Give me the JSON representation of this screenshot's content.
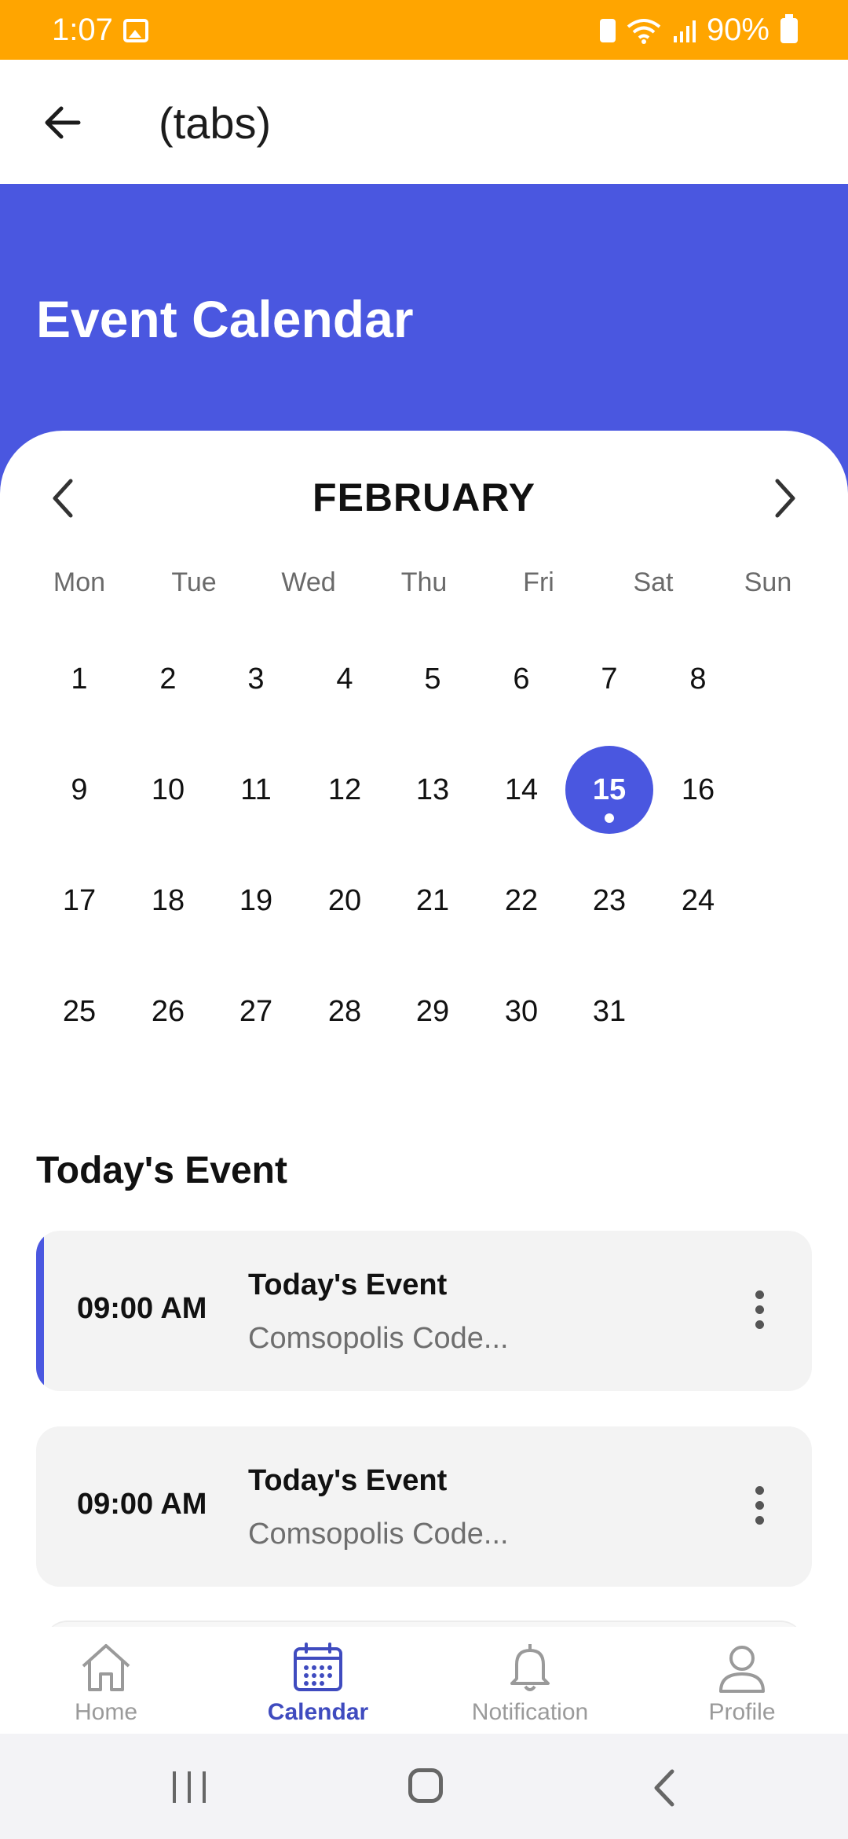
{
  "status": {
    "time": "1:07",
    "battery": "90%",
    "icons": [
      "image-icon",
      "battery-saver-icon",
      "wifi-icon",
      "signal-icon",
      "battery-icon"
    ]
  },
  "appbar": {
    "title": "(tabs)",
    "back_icon": "arrow-left-icon"
  },
  "banner": {
    "title": "Event Calendar",
    "color": "#4A57E0"
  },
  "calendar": {
    "month": "FEBRUARY",
    "weekdays": [
      "Mon",
      "Tue",
      "Wed",
      "Thu",
      "Fri",
      "Sat",
      "Sun"
    ],
    "days": [
      "1",
      "2",
      "3",
      "4",
      "5",
      "6",
      "7",
      "8",
      "9",
      "10",
      "11",
      "12",
      "13",
      "14",
      "15",
      "16",
      "17",
      "18",
      "19",
      "20",
      "21",
      "22",
      "23",
      "24",
      "25",
      "26",
      "27",
      "28",
      "29",
      "30",
      "31"
    ],
    "selected_day": "15",
    "accent": "#4A57E0"
  },
  "events": {
    "section_title": "Today's Event",
    "items": [
      {
        "time": "09:00 AM",
        "title": "Today's Event",
        "subtitle": "Comsopolis Code..."
      },
      {
        "time": "09:00 AM",
        "title": "Today's Event",
        "subtitle": "Comsopolis Code..."
      }
    ]
  },
  "bottom_nav": {
    "items": [
      {
        "label": "Home",
        "icon": "home-icon"
      },
      {
        "label": "Calendar",
        "icon": "calendar-icon",
        "active": true
      },
      {
        "label": "Notification",
        "icon": "bell-icon"
      },
      {
        "label": "Profile",
        "icon": "profile-icon"
      }
    ]
  }
}
